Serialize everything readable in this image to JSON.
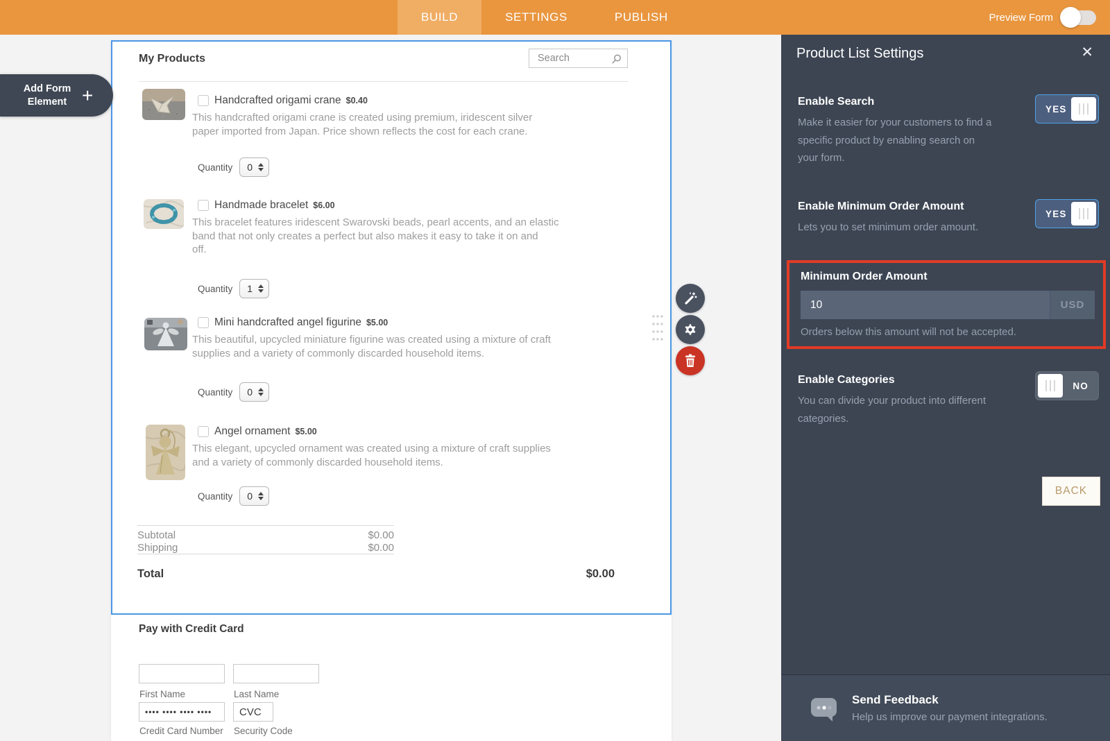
{
  "header": {
    "tabs": [
      {
        "label": "BUILD",
        "active": true
      },
      {
        "label": "SETTINGS",
        "active": false
      },
      {
        "label": "PUBLISH",
        "active": false
      }
    ],
    "preview_label": "Preview Form"
  },
  "canvas": {
    "add_element_label": "Add Form Element",
    "add_element_plus": "+"
  },
  "form": {
    "products_title": "My Products",
    "search_placeholder": "Search",
    "quantity_label": "Quantity",
    "products": [
      {
        "name": "Handcrafted origami crane",
        "price": "$0.40",
        "description": "This handcrafted origami crane is created using premium, iridescent silver\npaper imported from Japan. Price shown reflects the cost for each crane.",
        "quantity": "0"
      },
      {
        "name": "Handmade bracelet",
        "price": "$6.00",
        "description": "This bracelet features iridescent Swarovski beads, pearl accents, and an elastic\nband that not only creates a perfect but also makes it easy to take it on and\noff.",
        "quantity": "1"
      },
      {
        "name": "Mini handcrafted angel figurine",
        "price": "$5.00",
        "description": "This beautiful, upcycled miniature figurine was created using a mixture of craft\nsupplies and a variety of commonly discarded household items.",
        "quantity": "0"
      },
      {
        "name": "Angel ornament",
        "price": "$5.00",
        "description": "This elegant, upcycled ornament was created using a mixture of craft supplies\nand a variety of commonly discarded household items.",
        "quantity": "0"
      }
    ],
    "totals": {
      "subtotal_label": "Subtotal",
      "subtotal_value": "$0.00",
      "shipping_label": "Shipping",
      "shipping_value": "$0.00",
      "total_label": "Total",
      "total_value": "$0.00"
    },
    "payment": {
      "title": "Pay with Credit Card",
      "first_name_label": "First Name",
      "last_name_label": "Last Name",
      "card_number_label": "Credit Card Number",
      "card_number_value": "•••• •••• •••• ••••",
      "cvc_label": "Security Code",
      "cvc_value": "CVC"
    }
  },
  "settings_panel": {
    "title": "Product List Settings",
    "close_glyph": "✕",
    "enable_search": {
      "label": "Enable Search",
      "description": "Make it easier for your customers to find a\nspecific product by enabling search on\nyour form.",
      "toggle": "YES"
    },
    "enable_min_order": {
      "label": "Enable Minimum Order Amount",
      "description": "Lets you to set minimum order amount.",
      "toggle": "YES"
    },
    "min_order": {
      "label": "Minimum Order Amount",
      "value": "10",
      "currency": "USD",
      "helper": "Orders below this amount will not be accepted."
    },
    "enable_categories": {
      "label": "Enable Categories",
      "description": "You can divide your product into different\ncategories.",
      "toggle": "NO"
    },
    "back_label": "BACK",
    "feedback": {
      "title": "Send Feedback",
      "description": "Help us improve our payment integrations."
    }
  },
  "colors": {
    "header_orange": "#e9963f",
    "active_tab_orange": "#f0ad64",
    "panel_bg": "#3d4553",
    "selection_blue": "#4a97e5",
    "annotation_red": "#e23b25",
    "toggle_yes_track": "#4d5f7f",
    "toggle_yes_border": "#4da3e8",
    "toggle_no_track": "#59626f",
    "delete_red": "#ca3425",
    "back_text_tan": "#b89a6c"
  }
}
